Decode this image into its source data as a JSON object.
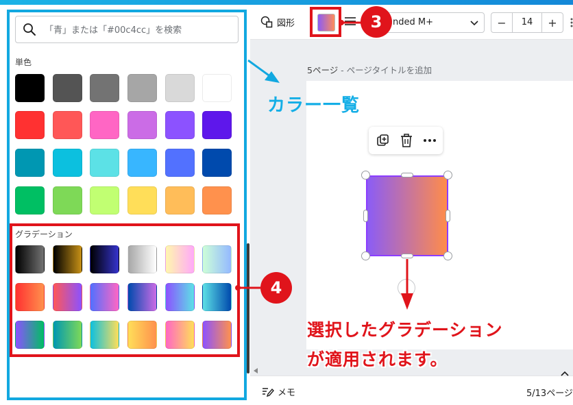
{
  "search": {
    "placeholder": "「青」または「#00c4cc」を検索"
  },
  "solid": {
    "label": "単色",
    "colors": [
      "#000000",
      "#545454",
      "#737373",
      "#a6a6a6",
      "#d9d9d9",
      "#ffffff",
      "#ff3131",
      "#ff5757",
      "#ff66c4",
      "#cb6ce6",
      "#8c52ff",
      "#5e17eb",
      "#0097b2",
      "#0cc0df",
      "#5ce1e6",
      "#38b6ff",
      "#5271ff",
      "#004aad",
      "#00bf63",
      "#7ed957",
      "#c1ff72",
      "#ffde59",
      "#ffbd59",
      "#ff914d"
    ]
  },
  "gradient": {
    "label": "グラデーション",
    "gradients": [
      [
        "#000000",
        "#737373"
      ],
      [
        "#000000",
        "#c89116"
      ],
      [
        "#000000",
        "#3533cd"
      ],
      [
        "#a6a6a6",
        "#ffffff"
      ],
      [
        "#fff7ad",
        "#ffa9f9"
      ],
      [
        "#cdffd8",
        "#94b9ff"
      ],
      [
        "#ff3131",
        "#ff914d"
      ],
      [
        "#ff5757",
        "#8c52ff"
      ],
      [
        "#5170ff",
        "#ff66c4"
      ],
      [
        "#004aad",
        "#cb6ce6"
      ],
      [
        "#8c52ff",
        "#5ce1e6"
      ],
      [
        "#5de0e6",
        "#004aad"
      ],
      [
        "#8c52ff",
        "#00bf63"
      ],
      [
        "#0097b2",
        "#7ed957"
      ],
      [
        "#0cc0df",
        "#ffde59"
      ],
      [
        "#ffde59",
        "#ff914d"
      ],
      [
        "#ff66c4",
        "#ffde59"
      ],
      [
        "#8c52ff",
        "#ff914d"
      ]
    ]
  },
  "toolbar": {
    "shape_label": "図形",
    "font_name": "nded M+",
    "font_size": "14",
    "minus": "−",
    "plus": "+",
    "current_color": [
      "#8b5cf6",
      "#ff8c5a"
    ]
  },
  "page": {
    "label": "5ページ",
    "sub_label": " - ページタイトルを追加"
  },
  "annotations": {
    "heading": "カラー一覧",
    "callout3": "3",
    "callout4": "4",
    "result_line1": "選択したグラデーション",
    "result_line2": "が適用されます。",
    "color_blue": "#12a8e0",
    "color_red": "#e0141b"
  },
  "bottom": {
    "memo_label": "メモ",
    "page_count": "5/13ページ"
  }
}
